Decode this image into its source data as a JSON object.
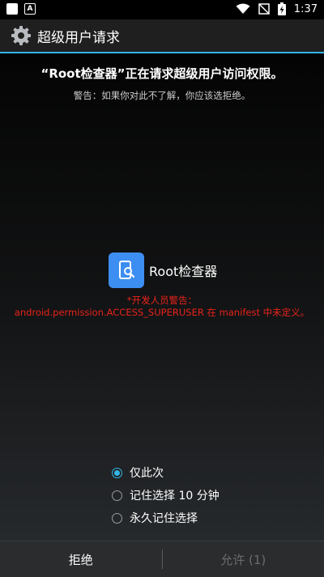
{
  "status_bar": {
    "time": "1:37",
    "left_icons": [
      "notification-square-icon",
      "text-a-icon"
    ],
    "right_icons": [
      "wifi-icon",
      "no-signal-icon",
      "battery-charging-icon"
    ]
  },
  "title_bar": {
    "title": "超级用户请求",
    "icon": "gear-icon"
  },
  "dialog": {
    "heading": "“Root检查器”正在请求超级用户访问权限。",
    "warning": "警告：如果你对此不了解，你应该选拒绝。",
    "app_name": "Root检查器",
    "app_icon": "phone-search-icon",
    "dev_warning_line1": "*开发人员警告：",
    "dev_warning_line2": "android.permission.ACCESS_SUPERUSER 在 manifest 中未定义。"
  },
  "options": [
    {
      "label": "仅此次",
      "checked": true
    },
    {
      "label": "记住选择 10 分钟",
      "checked": false
    },
    {
      "label": "永久记住选择",
      "checked": false
    }
  ],
  "buttons": {
    "deny": "拒绝",
    "allow": "允许 (1)"
  },
  "colors": {
    "accent": "#33b5e5",
    "warning_red": "#e8231b",
    "app_icon_bg": "#3d8ef2",
    "disabled_text": "#6a6c6e"
  }
}
